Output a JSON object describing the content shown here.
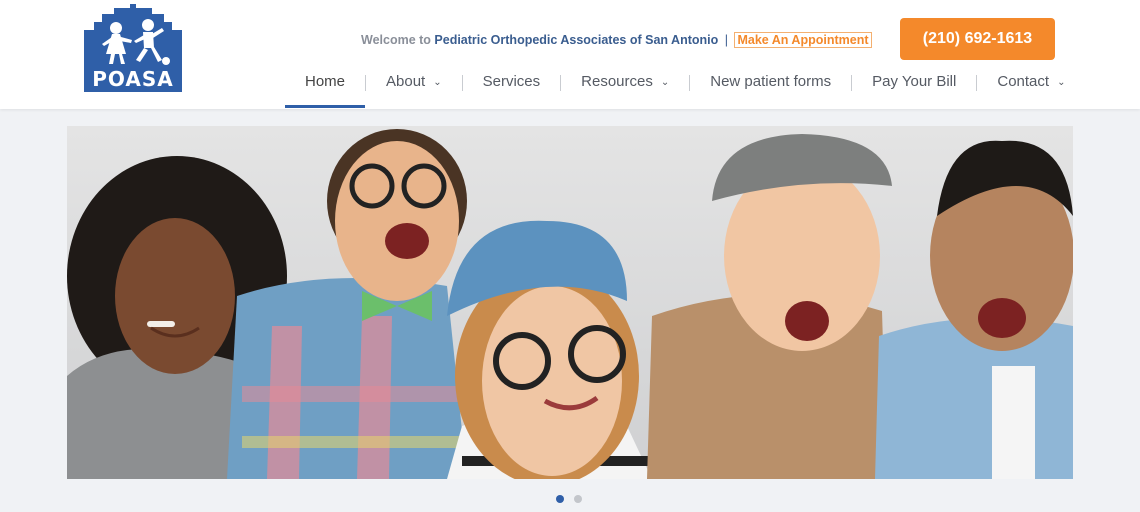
{
  "logo": {
    "text": "POASA",
    "icon": "children-playing-house-icon",
    "brand_color": "#2f5fa8"
  },
  "header": {
    "welcome_prefix": "Welcome to",
    "org_name": "Pediatric Orthopedic Associates of San Antonio",
    "separator": "|",
    "appointment_link": "Make An Appointment",
    "phone": "(210) 692-1613",
    "accent_color": "#f4892b"
  },
  "nav": {
    "items": [
      {
        "label": "Home",
        "active": true
      },
      {
        "label": "About",
        "dropdown": true
      },
      {
        "label": "Services"
      },
      {
        "label": "Resources",
        "dropdown": true
      },
      {
        "label": "New patient forms"
      },
      {
        "label": "Pay Your Bill"
      },
      {
        "label": "Contact",
        "dropdown": true
      }
    ],
    "chevron_icon": "chevron-down-icon"
  },
  "hero": {
    "image": "five-smiling-children-photo",
    "slide_count": 2,
    "active_slide": 1
  }
}
